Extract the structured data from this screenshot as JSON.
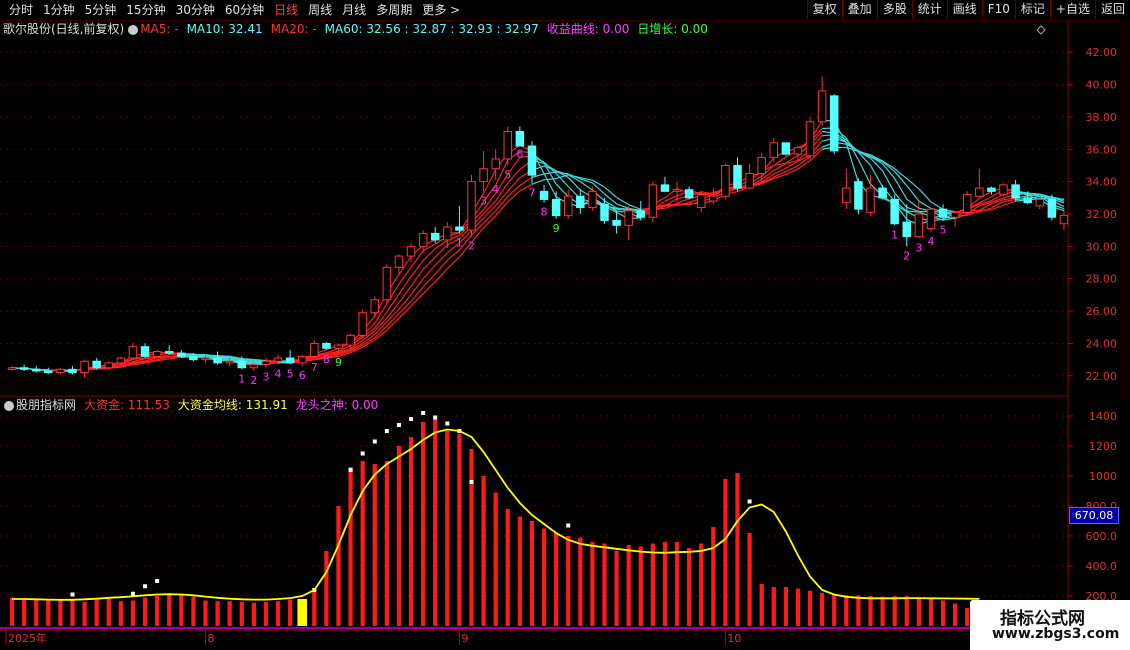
{
  "toolbar": {
    "periods": [
      "分时",
      "1分钟",
      "5分钟",
      "15分钟",
      "30分钟",
      "60分钟",
      "日线",
      "周线",
      "月线",
      "多周期",
      "更多 >"
    ],
    "active_period": "日线",
    "buttons": [
      "复权",
      "叠加",
      "多股",
      "统计",
      "画线",
      "F10",
      "标记",
      "+自选",
      "返回"
    ]
  },
  "main_panel": {
    "stock_title": "歌尔股份(日线,前复权)",
    "ma5": "MA5: -",
    "ma10": "MA10: 32.41",
    "ma20": "MA20: -",
    "ma60": "MA60: 32.56 : 32.87 : 32.93 : 32.97",
    "profit_curve": "收益曲线: 0.00",
    "daily_growth": "日增长: 0.00"
  },
  "sub_panel": {
    "title": "股朋指标网",
    "big_fund": "大资金: 111.53",
    "big_fund_avg": "大资金均线: 131.91",
    "dragon": "龙头之神: 0.00",
    "value_label": "670.08"
  },
  "price_axis": {
    "ticks": [
      "42.00",
      "40.00",
      "38.00",
      "36.00",
      "34.00",
      "32.00",
      "30.00",
      "28.00",
      "26.00",
      "24.00",
      "22.00"
    ]
  },
  "volume_axis": {
    "ticks": [
      "1400",
      "1200",
      "1000",
      "800.0",
      "600.0",
      "400.0",
      "200.0"
    ]
  },
  "date_axis": {
    "labels": [
      "2025年",
      "8",
      "9",
      "10"
    ]
  },
  "watermark": {
    "line1": "指标公式网",
    "line2": "www.zbgs3.com"
  },
  "colors": {
    "up": "#ff3232",
    "down": "#54ffff",
    "ma": "#ffff00",
    "bg": "#000000"
  },
  "chart_data": {
    "type": "candlestick",
    "ohlc": [
      [
        22.4,
        22.6,
        22.3,
        22.5
      ],
      [
        22.5,
        22.7,
        22.3,
        22.4
      ],
      [
        22.4,
        22.6,
        22.2,
        22.3
      ],
      [
        22.3,
        22.5,
        22.1,
        22.2
      ],
      [
        22.2,
        22.5,
        22.1,
        22.4
      ],
      [
        22.4,
        22.6,
        22.1,
        22.2
      ],
      [
        22.2,
        23.0,
        21.9,
        22.9
      ],
      [
        22.9,
        23.1,
        22.4,
        22.5
      ],
      [
        22.5,
        22.9,
        22.4,
        22.8
      ],
      [
        22.8,
        23.2,
        22.7,
        23.1
      ],
      [
        23.1,
        24.0,
        23.0,
        23.8
      ],
      [
        23.8,
        24.0,
        23.1,
        23.2
      ],
      [
        23.2,
        23.6,
        23.1,
        23.5
      ],
      [
        23.5,
        23.9,
        23.3,
        23.4
      ],
      [
        23.4,
        23.6,
        23.1,
        23.2
      ],
      [
        23.2,
        23.4,
        22.9,
        23.0
      ],
      [
        23.0,
        23.3,
        22.8,
        23.1
      ],
      [
        23.1,
        23.5,
        22.7,
        22.8
      ],
      [
        22.8,
        23.1,
        22.6,
        22.9
      ],
      [
        22.9,
        23.2,
        22.4,
        22.5
      ],
      [
        22.5,
        22.8,
        22.3,
        22.7
      ],
      [
        22.7,
        23.1,
        22.5,
        22.9
      ],
      [
        22.9,
        23.3,
        22.7,
        23.1
      ],
      [
        23.1,
        23.6,
        22.7,
        22.8
      ],
      [
        22.8,
        23.3,
        22.6,
        23.2
      ],
      [
        23.2,
        24.2,
        23.1,
        24.0
      ],
      [
        24.0,
        24.1,
        23.6,
        23.7
      ],
      [
        23.7,
        24.0,
        23.4,
        23.9
      ],
      [
        23.9,
        24.6,
        23.6,
        24.5
      ],
      [
        24.5,
        26.1,
        24.3,
        25.9
      ],
      [
        25.9,
        26.9,
        25.6,
        26.7
      ],
      [
        26.7,
        28.9,
        26.5,
        28.7
      ],
      [
        28.7,
        29.5,
        28.2,
        29.4
      ],
      [
        29.4,
        30.2,
        29.0,
        30.0
      ],
      [
        30.0,
        31.0,
        29.6,
        30.8
      ],
      [
        30.8,
        31.2,
        30.2,
        30.4
      ],
      [
        30.4,
        31.5,
        29.9,
        31.2
      ],
      [
        31.2,
        32.5,
        30.8,
        31.0
      ],
      [
        31.0,
        34.4,
        30.6,
        34.0
      ],
      [
        34.0,
        35.9,
        33.4,
        34.8
      ],
      [
        34.8,
        36.0,
        34.1,
        35.4
      ],
      [
        35.4,
        37.4,
        35.0,
        37.1
      ],
      [
        37.1,
        37.4,
        36.3,
        36.2
      ],
      [
        36.2,
        36.5,
        33.9,
        34.4
      ],
      [
        33.4,
        33.8,
        32.7,
        32.9
      ],
      [
        32.9,
        33.4,
        31.7,
        31.9
      ],
      [
        31.9,
        33.5,
        31.7,
        33.1
      ],
      [
        33.1,
        33.5,
        32.0,
        32.4
      ],
      [
        32.4,
        33.7,
        32.2,
        33.4
      ],
      [
        32.6,
        33.0,
        31.4,
        31.6
      ],
      [
        31.6,
        32.2,
        30.8,
        31.3
      ],
      [
        31.3,
        32.5,
        30.4,
        32.2
      ],
      [
        32.2,
        32.8,
        31.6,
        31.8
      ],
      [
        31.8,
        34.0,
        31.5,
        33.8
      ],
      [
        33.8,
        34.3,
        33.4,
        33.4
      ],
      [
        33.4,
        34.0,
        32.8,
        33.5
      ],
      [
        33.5,
        33.7,
        32.9,
        33.0
      ],
      [
        32.4,
        33.4,
        32.1,
        33.2
      ],
      [
        32.8,
        33.6,
        32.6,
        33.1
      ],
      [
        33.1,
        35.1,
        32.9,
        35.0
      ],
      [
        35.0,
        35.5,
        33.4,
        33.6
      ],
      [
        33.6,
        35.1,
        33.5,
        34.5
      ],
      [
        34.5,
        35.8,
        34.0,
        35.5
      ],
      [
        35.5,
        36.7,
        35.2,
        36.4
      ],
      [
        36.4,
        36.4,
        35.6,
        35.7
      ],
      [
        35.7,
        36.2,
        35.3,
        36.1
      ],
      [
        35.6,
        38.0,
        35.4,
        37.7
      ],
      [
        37.7,
        40.5,
        37.4,
        39.6
      ],
      [
        39.3,
        39.4,
        35.7,
        35.9
      ],
      [
        32.7,
        34.8,
        32.3,
        33.6
      ],
      [
        34.0,
        34.2,
        32.0,
        32.3
      ],
      [
        32.1,
        34.4,
        31.9,
        33.6
      ],
      [
        33.6,
        33.8,
        32.9,
        33.0
      ],
      [
        32.9,
        33.2,
        31.3,
        31.4
      ],
      [
        31.5,
        32.6,
        30.0,
        30.6
      ],
      [
        30.6,
        32.8,
        30.5,
        32.0
      ],
      [
        31.1,
        32.4,
        30.9,
        32.3
      ],
      [
        32.3,
        32.6,
        31.6,
        31.8
      ],
      [
        31.8,
        32.2,
        31.2,
        32.1
      ],
      [
        32.1,
        33.4,
        32.0,
        33.2
      ],
      [
        33.1,
        34.8,
        33.0,
        33.6
      ],
      [
        33.6,
        33.7,
        33.2,
        33.4
      ],
      [
        33.2,
        33.9,
        33.1,
        33.8
      ],
      [
        33.8,
        34.1,
        32.8,
        33.0
      ],
      [
        33.0,
        33.4,
        32.6,
        32.7
      ],
      [
        32.5,
        33.2,
        32.3,
        32.9
      ],
      [
        32.9,
        33.2,
        31.6,
        31.8
      ],
      [
        31.4,
        32.3,
        31.0,
        31.9
      ]
    ],
    "big_fund": [
      190,
      180,
      175,
      170,
      175,
      180,
      160,
      175,
      180,
      165,
      170,
      190,
      200,
      215,
      210,
      195,
      170,
      165,
      165,
      160,
      155,
      160,
      165,
      175,
      180,
      230,
      500,
      800,
      1060,
      1100,
      1080,
      1100,
      1200,
      1260,
      1360,
      1380,
      1300,
      1280,
      1180,
      1000,
      890,
      780,
      730,
      700,
      650,
      620,
      600,
      590,
      560,
      550,
      500,
      540,
      530,
      550,
      560,
      560,
      520,
      550,
      660,
      980,
      1020,
      620,
      280,
      260,
      260,
      250,
      235,
      220,
      210,
      205,
      205,
      200,
      195,
      200,
      200,
      190,
      190,
      170,
      150,
      120,
      100
    ],
    "big_fund_signals": [
      null,
      null,
      null,
      null,
      null,
      210,
      null,
      null,
      null,
      null,
      215,
      265,
      300,
      null,
      null,
      null,
      null,
      null,
      null,
      null,
      null,
      null,
      null,
      null,
      null,
      240,
      null,
      null,
      1040,
      1150,
      1230,
      1300,
      1340,
      1380,
      1420,
      1390,
      1350,
      1300,
      960,
      null,
      null,
      null,
      null,
      null,
      null,
      null,
      670,
      null,
      null,
      null,
      null,
      null,
      null,
      null,
      null,
      null,
      null,
      null,
      null,
      null,
      null,
      830,
      null,
      null,
      null,
      null,
      null,
      null,
      null,
      null,
      null,
      null,
      null,
      null,
      null,
      null,
      null,
      null,
      null,
      null,
      null
    ],
    "big_fund_avg": [
      180,
      180,
      178,
      176,
      175,
      175,
      178,
      182,
      188,
      192,
      198,
      205,
      210,
      212,
      210,
      205,
      196,
      188,
      182,
      178,
      176,
      176,
      180,
      186,
      200,
      240,
      360,
      540,
      740,
      900,
      1010,
      1080,
      1130,
      1180,
      1240,
      1290,
      1310,
      1300,
      1260,
      1160,
      1040,
      920,
      820,
      740,
      680,
      620,
      575,
      548,
      535,
      525,
      515,
      505,
      496,
      490,
      488,
      492,
      495,
      500,
      520,
      580,
      700,
      790,
      810,
      760,
      630,
      470,
      330,
      240,
      210,
      195,
      188,
      185,
      185,
      185,
      186,
      186,
      185,
      184,
      183,
      182,
      181
    ],
    "highlight_bar": 24,
    "seq_labels": [
      {
        "i": 19,
        "t": "1",
        "c": "#ff30ff"
      },
      {
        "i": 20,
        "t": "2",
        "c": "#ff30ff"
      },
      {
        "i": 21,
        "t": "3",
        "c": "#ff30ff"
      },
      {
        "i": 22,
        "t": "4",
        "c": "#ff30ff"
      },
      {
        "i": 23,
        "t": "5",
        "c": "#ff30ff"
      },
      {
        "i": 24,
        "t": "6",
        "c": "#ff30ff"
      },
      {
        "i": 25,
        "t": "7",
        "c": "#ff30ff"
      },
      {
        "i": 26,
        "t": "8",
        "c": "#ff30ff"
      },
      {
        "i": 27,
        "t": "9",
        "c": "#30ff30"
      },
      {
        "i": 37,
        "t": "1",
        "c": "#ff30ff"
      },
      {
        "i": 38,
        "t": "2",
        "c": "#ff30ff"
      },
      {
        "i": 39,
        "t": "3",
        "c": "#ff30ff"
      },
      {
        "i": 40,
        "t": "4",
        "c": "#ff30ff"
      },
      {
        "i": 41,
        "t": "5",
        "c": "#ff30ff"
      },
      {
        "i": 42,
        "t": "6",
        "c": "#ff30ff"
      },
      {
        "i": 43,
        "t": "7",
        "c": "#ff30ff"
      },
      {
        "i": 44,
        "t": "8",
        "c": "#ff30ff"
      },
      {
        "i": 45,
        "t": "9",
        "c": "#30ff30"
      },
      {
        "i": 73,
        "t": "1",
        "c": "#ff30ff"
      },
      {
        "i": 74,
        "t": "2",
        "c": "#ff30ff"
      },
      {
        "i": 75,
        "t": "3",
        "c": "#ff30ff"
      },
      {
        "i": 76,
        "t": "4",
        "c": "#ff30ff"
      },
      {
        "i": 77,
        "t": "5",
        "c": "#ff30ff"
      }
    ],
    "price_range": [
      21.0,
      43.0
    ],
    "volume_range": [
      0,
      1480
    ]
  }
}
